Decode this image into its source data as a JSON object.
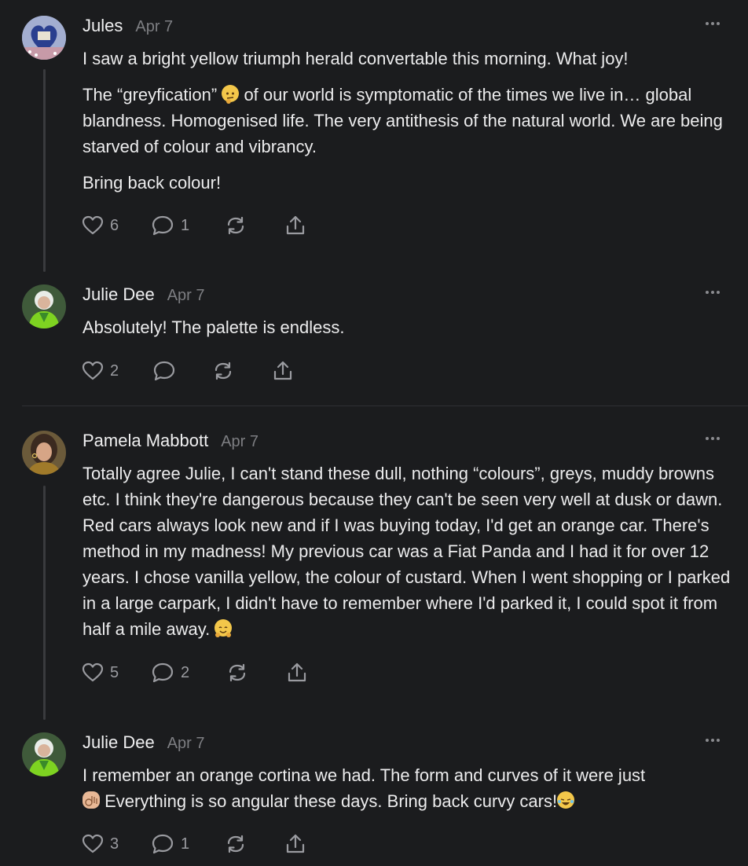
{
  "comments": [
    {
      "author": "Jules",
      "date": "Apr 7",
      "paragraphs": [
        "I saw a bright yellow triumph herald convertable this morning. What joy!",
        "of our world is symptomatic of the times we live in… global blandness. Homogenised life. The very antithesis of the natural world. We are being starved of colour and vibrancy.",
        "Bring back colour!"
      ],
      "quote_word": "The “greyfication”",
      "likes": "6",
      "replies": "1"
    },
    {
      "author": "Julie Dee",
      "date": "Apr 7",
      "paragraphs": [
        "Absolutely! The palette is endless."
      ],
      "likes": "2",
      "replies": ""
    },
    {
      "author": "Pamela Mabbott",
      "date": "Apr 7",
      "paragraphs": [
        "Totally agree Julie, I can't stand these dull, nothing “colours”, greys, muddy browns etc. I think they're dangerous because they can't be seen very well at dusk or dawn. Red cars always look new and if I was buying today, I'd get an orange car. There's method in my madness! My previous car was a Fiat Panda and I had it for over 12 years. I chose vanilla yellow, the colour of custard. When I went shopping or I parked in a large carpark, I didn't have to remember where I'd parked it, I could spot it from half a mile away."
      ],
      "likes": "5",
      "replies": "2"
    },
    {
      "author": "Julie Dee",
      "date": "Apr 7",
      "line1": "I remember an orange cortina we had. The form and curves of it were just",
      "line2": "Everything is so angular these days. Bring back curvy cars!",
      "likes": "3",
      "replies": "1"
    }
  ],
  "icons": {
    "like": "heart-icon",
    "reply": "comment-icon",
    "restack": "restack-icon",
    "share": "share-icon",
    "more": "more-icon"
  },
  "colors": {
    "background": "#1b1c1e",
    "text": "#ececed",
    "muted": "#7d7e82",
    "icon": "#9a9ba0"
  }
}
